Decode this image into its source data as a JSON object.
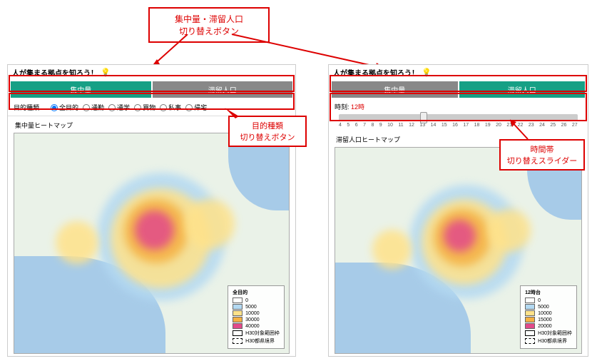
{
  "callouts": {
    "top": "集中量・滞留人口\n切り替えボタン",
    "purpose": "目的種類\n切り替えボタン",
    "slider": "時間帯\n切り替えスライダー"
  },
  "shared": {
    "title": "人が集まる拠点を知ろう！"
  },
  "left": {
    "tabs": {
      "active": "集中量",
      "inactive": "滞留人口"
    },
    "purpose_label": "目的種類",
    "purposes": [
      "全目的",
      "通勤",
      "通学",
      "買物",
      "私事",
      "帰宅"
    ],
    "map_title": "集中量ヒートマップ",
    "legend_title": "全目的",
    "legend": [
      {
        "color": "#ffffff",
        "label": "0"
      },
      {
        "color": "#b3d9f2",
        "label": "5000"
      },
      {
        "color": "#ffe28a",
        "label": "10000"
      },
      {
        "color": "#f5b042",
        "label": "30000"
      },
      {
        "color": "#e24a8a",
        "label": "40000"
      }
    ],
    "legend_extra": [
      "H30対象範囲枠",
      "H30都県境界"
    ]
  },
  "right": {
    "tabs": {
      "inactive": "集中量",
      "active": "滞留人口"
    },
    "time_label": "時刻:",
    "time_value": "12時",
    "ticks": [
      "4",
      "5",
      "6",
      "7",
      "8",
      "9",
      "10",
      "11",
      "12",
      "13",
      "14",
      "15",
      "16",
      "17",
      "18",
      "19",
      "20",
      "21",
      "22",
      "23",
      "24",
      "25",
      "26",
      "27"
    ],
    "map_title": "滞留人口ヒートマップ",
    "legend_title": "12時台",
    "legend": [
      {
        "color": "#ffffff",
        "label": "0"
      },
      {
        "color": "#b3d9f2",
        "label": "5000"
      },
      {
        "color": "#ffe28a",
        "label": "10000"
      },
      {
        "color": "#f5b042",
        "label": "15000"
      },
      {
        "color": "#e24a8a",
        "label": "20000"
      }
    ],
    "legend_extra": [
      "H30対象範囲枠",
      "H30都県境界"
    ]
  }
}
